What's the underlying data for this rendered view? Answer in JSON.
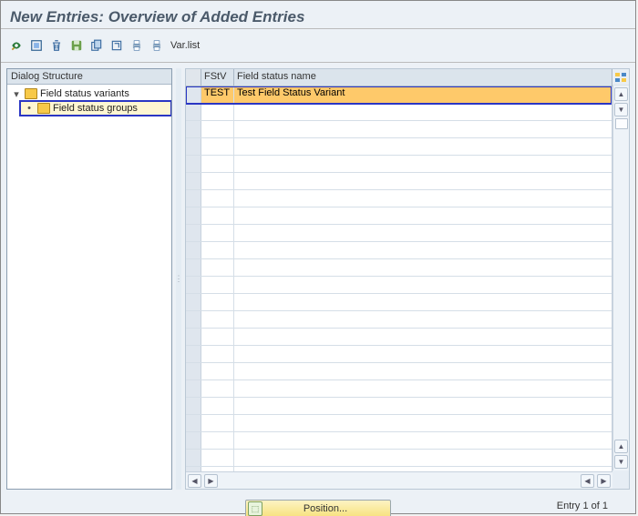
{
  "title": "New Entries: Overview of Added Entries",
  "toolbar": {
    "varlist_label": "Var.list"
  },
  "tree": {
    "header": "Dialog Structure",
    "root": {
      "label": "Field status variants"
    },
    "child": {
      "label": "Field status groups"
    }
  },
  "table": {
    "headers": {
      "col1": "FStV",
      "col2": "Field status name"
    },
    "rows": [
      {
        "fstv": "TEST",
        "name": "Test Field Status Variant"
      }
    ]
  },
  "footer": {
    "position_label": "Position...",
    "entry_counter": "Entry 1 of 1"
  }
}
